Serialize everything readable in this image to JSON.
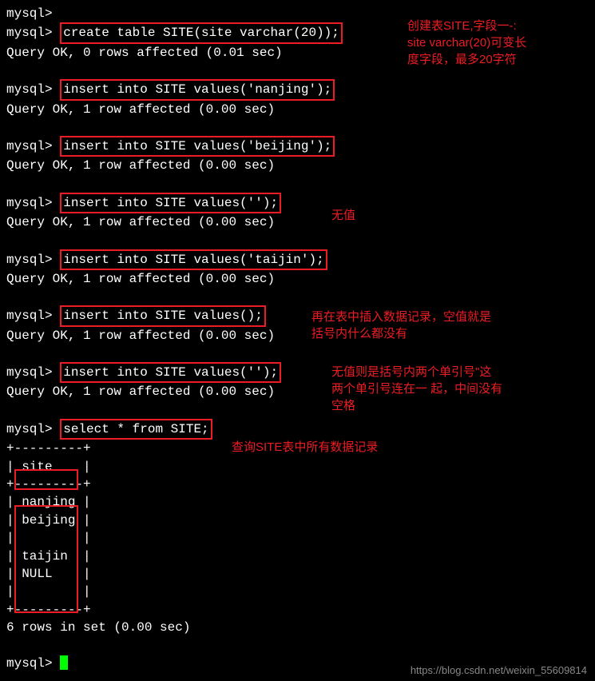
{
  "prompt": "mysql>",
  "lines": {
    "blank_prompt": "mysql>",
    "cmd1": "create table SITE(site varchar(20));",
    "result1": "Query OK, 0 rows affected (0.01 sec)",
    "cmd2": "insert into SITE values('nanjing');",
    "result2": "Query OK, 1 row affected (0.00 sec)",
    "cmd3": "insert into SITE values('beijing');",
    "result3": "Query OK, 1 row affected (0.00 sec)",
    "cmd4": "insert into SITE values('');",
    "result4": "Query OK, 1 row affected (0.00 sec)",
    "cmd5": "insert into SITE values('taijin');",
    "result5": "Query OK, 1 row affected (0.00 sec)",
    "cmd6": "insert into SITE values();",
    "result6": "Query OK, 1 row affected (0.00 sec)",
    "cmd7": "insert into SITE values('');",
    "result7": "Query OK, 1 row affected (0.00 sec)",
    "cmd8": "select * from SITE;",
    "table_sep": "+---------+",
    "table_header": "| site    |",
    "row1": "| nanjing |",
    "row2": "| beijing |",
    "row3": "|         |",
    "row4": "| taijin  |",
    "row5": "| NULL    |",
    "row6": "|         |",
    "summary": "6 rows in set (0.00 sec)"
  },
  "annotations": {
    "a1": "创建表SITE,字段一-:\nsite varchar(20)可变长\n度字段，最多20字符",
    "a2": "无值",
    "a3": "再在表中插入数据记录，空值就是\n括号内什么都没有",
    "a4": "无值则是括号内两个单引号\"这\n两个单引号连在一 起，中间没有\n空格",
    "a5": "查询SITE表中所有数据记录"
  },
  "watermark": "https://blog.csdn.net/weixin_55609814"
}
